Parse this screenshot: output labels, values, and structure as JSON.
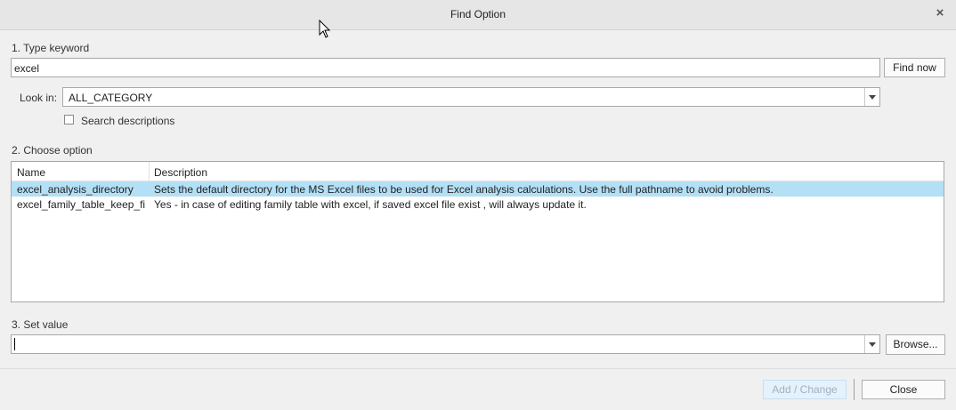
{
  "window": {
    "title": "Find Option",
    "close_glyph": "×"
  },
  "section1": {
    "label": "1.  Type keyword"
  },
  "keyword": {
    "value": "excel"
  },
  "find_now": {
    "label": "Find now"
  },
  "look_in": {
    "label": "Look in:",
    "value": "ALL_CATEGORY"
  },
  "search_desc": {
    "label": "Search descriptions",
    "checked": false
  },
  "section2": {
    "label": "2.  Choose option"
  },
  "table": {
    "headers": {
      "name": "Name",
      "description": "Description"
    },
    "rows": [
      {
        "name": "excel_analysis_directory",
        "description": "Sets the default directory for the MS Excel files to be used for Excel analysis calculations. Use the full pathname to avoid problems.",
        "selected": true
      },
      {
        "name": "excel_family_table_keep_file",
        "description": "Yes - in case of editing family table with excel, if saved excel file exist , will always update it.",
        "selected": false
      }
    ]
  },
  "section3": {
    "label": "3.  Set value"
  },
  "set_value": {
    "value": ""
  },
  "browse": {
    "label": "Browse..."
  },
  "add_change": {
    "label": "Add / Change"
  },
  "close": {
    "label": "Close"
  },
  "colors": {
    "selection": "#b3e0f5",
    "background": "#f0f0f0"
  }
}
